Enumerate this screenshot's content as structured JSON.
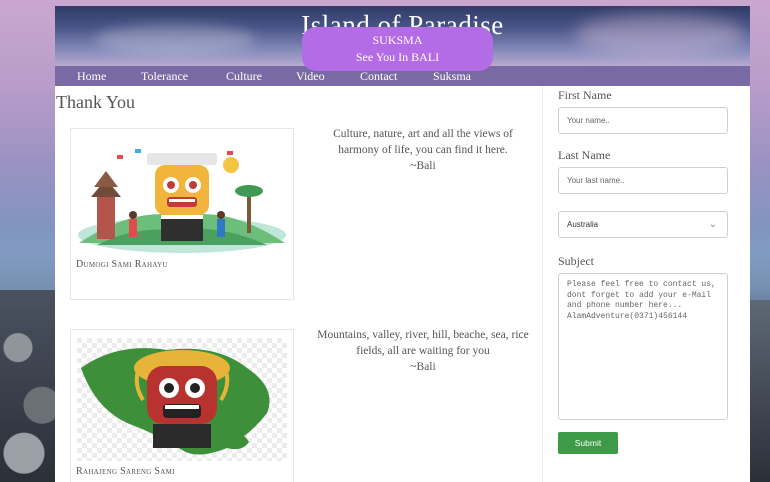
{
  "header": {
    "title": "Island of Paradise",
    "banner_line1": "SUKSMA",
    "banner_line2": "See You In BALI"
  },
  "nav": {
    "items": [
      {
        "label": "Home"
      },
      {
        "label": "Tolerance"
      },
      {
        "label": "Culture"
      },
      {
        "label": "Video"
      },
      {
        "label": "Contact"
      },
      {
        "label": "Suksma"
      }
    ]
  },
  "main": {
    "heading": "Thank You",
    "cards": [
      {
        "caption": "Dumogi Sami Rahayu"
      },
      {
        "caption": "Rahajeng Sareng Sami"
      }
    ],
    "quotes": [
      {
        "text": "Culture, nature, art and all the views of harmony of life, you can find it here.",
        "author": "~Bali"
      },
      {
        "text": "Mountains, valley, river, hill, beache, sea, rice fields, all are waiting for you",
        "author": "~Bali"
      }
    ]
  },
  "form": {
    "first_name_label": "First Name",
    "first_name_placeholder": "Your name..",
    "last_name_label": "Last Name",
    "last_name_placeholder": "Your last name..",
    "country_selected": "Australia",
    "subject_label": "Subject",
    "subject_value": "Please feel free to contact us, dont forget to add your e-Mail and phone number here...\nAlamAdventure(0371)456144",
    "submit_label": "Submit"
  },
  "colors": {
    "nav_bar": "#7a6aa4",
    "banner": "#b36be6",
    "submit": "#3d9a47"
  }
}
